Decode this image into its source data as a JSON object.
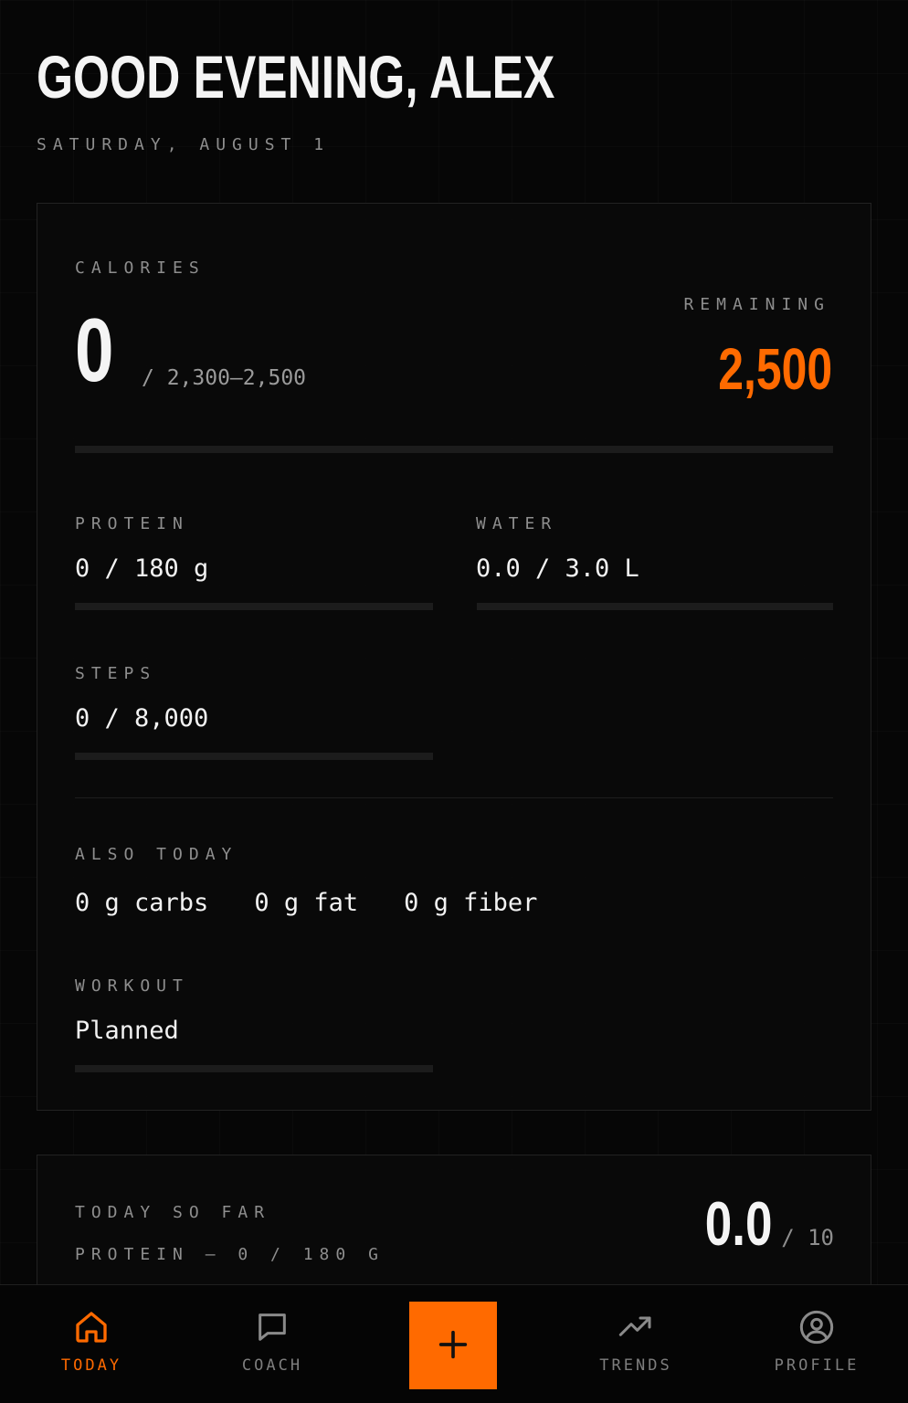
{
  "header": {
    "greeting": "GOOD EVENING, ALEX",
    "date": "SATURDAY, AUGUST 1"
  },
  "calories": {
    "label": "CALORIES",
    "value": "0",
    "target": "/ 2,300–2,500",
    "remaining_label": "REMAINING",
    "remaining_value": "2,500",
    "progress": 0
  },
  "metrics": {
    "protein": {
      "label": "PROTEIN",
      "value": "0 / 180 g",
      "progress": 0
    },
    "water": {
      "label": "WATER",
      "value": "0.0 / 3.0 L",
      "progress": 0
    },
    "steps": {
      "label": "STEPS",
      "value": "0 / 8,000",
      "progress": 0
    }
  },
  "also_today": {
    "label": "ALSO TODAY",
    "items": [
      "0 g carbs",
      "0 g fat",
      "0 g fiber"
    ]
  },
  "workout": {
    "label": "WORKOUT",
    "value": "Planned",
    "progress": 0
  },
  "today_so_far": {
    "label": "TODAY SO FAR",
    "sub": "PROTEIN — 0 / 180 G",
    "score": "0.0",
    "score_max": "/ 10"
  },
  "nav": {
    "today": "TODAY",
    "coach": "COACH",
    "trends": "TRENDS",
    "profile": "PROFILE",
    "active": "today",
    "add_icon": "plus-icon"
  },
  "colors": {
    "accent": "#ff6a00",
    "background": "#060606",
    "muted": "#8e8e8e"
  }
}
